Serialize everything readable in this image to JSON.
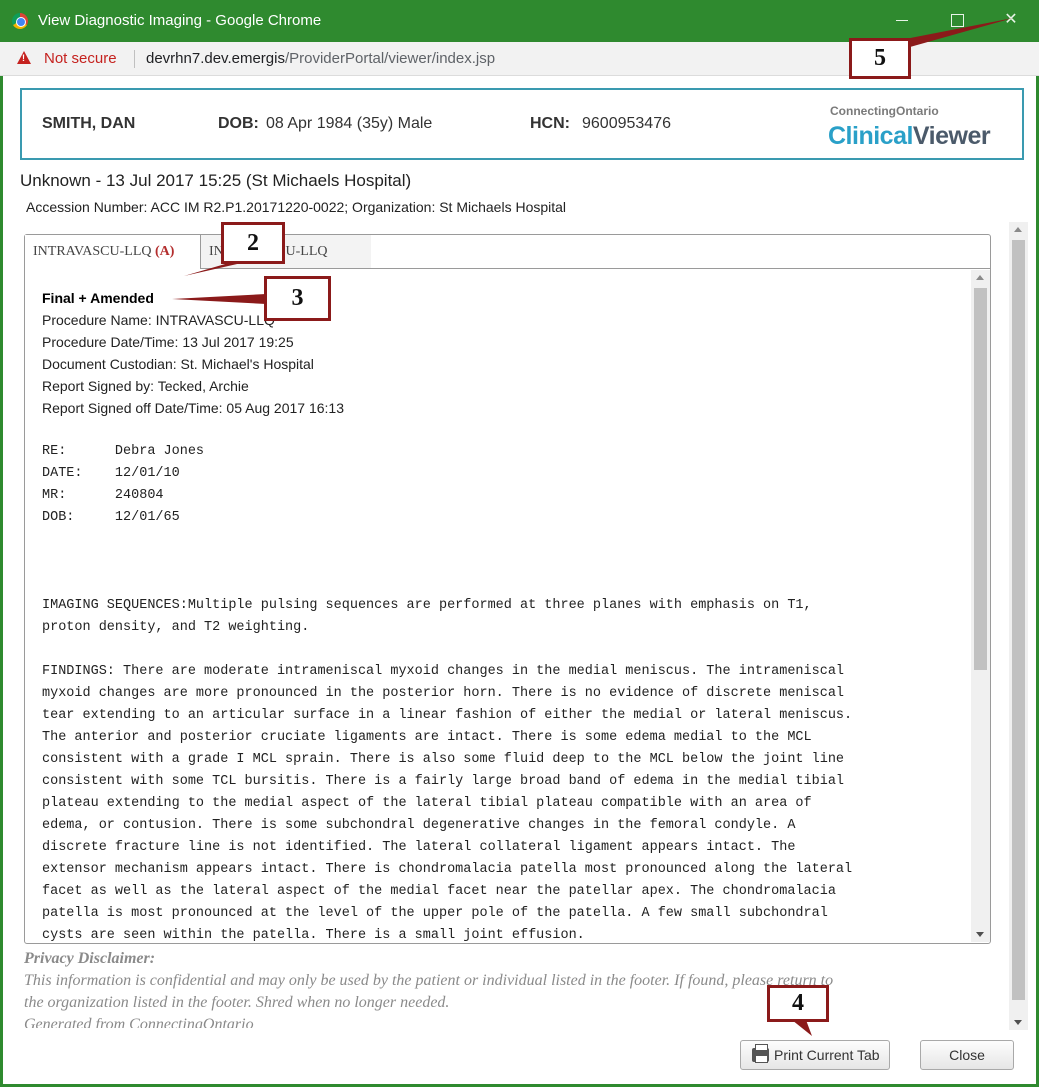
{
  "window": {
    "title": "View Diagnostic Imaging - Google Chrome",
    "security_label": "Not secure",
    "url_host": "devrhn7.dev.emergis",
    "url_path": "/ProviderPortal/viewer/index.jsp"
  },
  "patient": {
    "name": "SMITH, DAN",
    "dob_label": "DOB:",
    "dob_value": "08 Apr 1984 (35y) Male",
    "hcn_label": "HCN:",
    "hcn_value": "9600953476"
  },
  "brand": {
    "top": "ConnectingOntario",
    "main_part1": "Clinical",
    "main_part2": "Viewer"
  },
  "study": {
    "title": "Unknown - 13 Jul 2017 15:25 (St Michaels Hospital)",
    "accession": "Accession Number: ACC IM R2.P1.20171220-0022; Organization: St Michaels Hospital"
  },
  "tabs": [
    {
      "label": "INTRAVASCU-LLQ",
      "badge": "(A)"
    },
    {
      "label": "INTRAVASCU-LLQ"
    }
  ],
  "report": {
    "status": "Final + Amended",
    "procedure_name": "Procedure Name: INTRAVASCU-LLQ",
    "procedure_datetime": "Procedure Date/Time: 13 Jul 2017 19:25",
    "custodian": "Document Custodian: St. Michael's Hospital",
    "signed_by": "Report Signed by: Tecked, Archie",
    "signed_off": "Report Signed off Date/Time: 05 Aug 2017 16:13",
    "re": "RE:      Debra Jones",
    "date": "DATE:    12/01/10",
    "mr": "MR:      240804",
    "dob": "DOB:     12/01/65",
    "imaging_sequences": "IMAGING SEQUENCES:Multiple pulsing sequences are performed at three planes with emphasis on T1,\nproton density, and T2 weighting.",
    "findings": "FINDINGS: There are moderate intrameniscal myxoid changes in the medial meniscus. The intrameniscal\nmyxoid changes are more pronounced in the posterior horn. There is no evidence of discrete meniscal\ntear extending to an articular surface in a linear fashion of either the medial or lateral meniscus.\nThe anterior and posterior cruciate ligaments are intact. There is some edema medial to the MCL\nconsistent with a grade I MCL sprain. There is also some fluid deep to the MCL below the joint line\nconsistent with some TCL bursitis. There is a fairly large broad band of edema in the medial tibial\nplateau extending to the medial aspect of the lateral tibial plateau compatible with an area of\nedema, or contusion. There is some subchondral degenerative changes in the femoral condyle. A\ndiscrete fracture line is not identified. The lateral collateral ligament appears intact. The\nextensor mechanism appears intact. There is chondromalacia patella most pronounced along the lateral\nfacet as well as the lateral aspect of the medial facet near the patellar apex. The chondromalacia\npatella is most pronounced at the level of the upper pole of the patella. A few small subchondral\ncysts are seen within the patella. There is a small joint effusion."
  },
  "disclaimer": {
    "title": "Privacy Disclaimer:",
    "line1": "This information is confidential and may only be used by the patient or individual listed in the footer. If found, please return to",
    "line2": "the organization listed in the footer. Shred when no longer needed.",
    "line3": "Generated from ConnectingOntario"
  },
  "buttons": {
    "print": "Print Current Tab",
    "close": "Close"
  },
  "callouts": {
    "c2": "2",
    "c3": "3",
    "c4": "4",
    "c5": "5"
  },
  "colors": {
    "titlebar": "#2f8a2f",
    "banner_border": "#3a9ab0",
    "callout_border": "#8b1a1a",
    "brand_clinical": "#2aa0c8",
    "brand_viewer": "#4b5a6a"
  }
}
